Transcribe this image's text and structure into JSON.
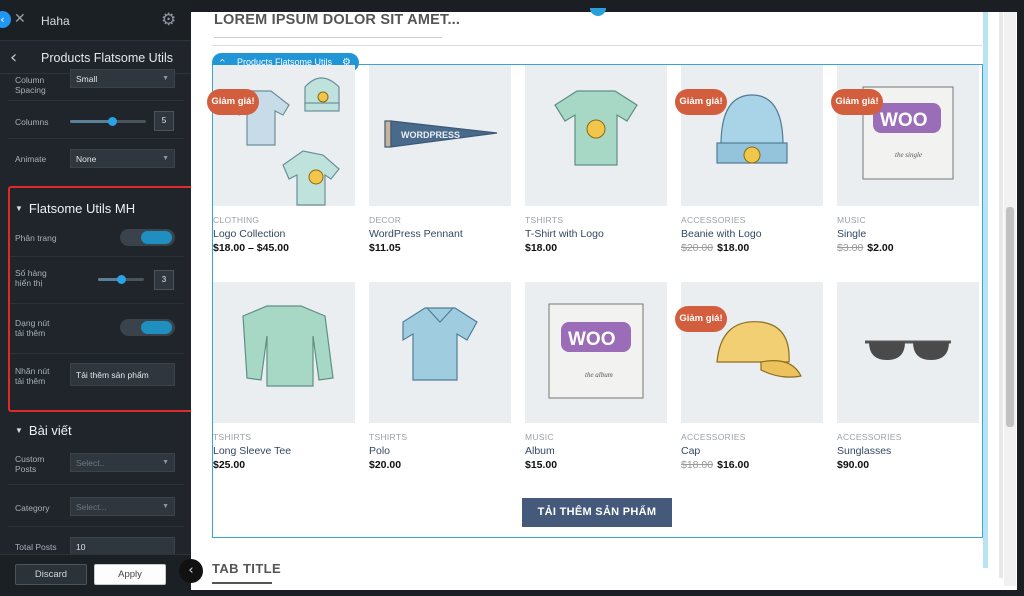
{
  "topbar": {
    "collapse_icon": "‹",
    "close_icon": "✕",
    "title": "Haha",
    "gear_icon": "⚙"
  },
  "subbar": {
    "back_icon": "‹",
    "title": "Products Flatsome Utils"
  },
  "panel": {
    "spacing": {
      "label": "Column\nSpacing",
      "value": "Small"
    },
    "columns": {
      "label": "Columns",
      "value": "5",
      "level": 0.55
    },
    "animate": {
      "label": "Animate",
      "value": "None"
    },
    "mh_section": {
      "title": "Flatsome Utils MH"
    },
    "phan_trang": {
      "label": "Phân trang",
      "on": true
    },
    "so_hang": {
      "label": "Số hàng\nhiển thị",
      "value": "3",
      "level": 0.49
    },
    "dang_nut": {
      "label": "Dạng nút\ntải thêm",
      "on": true
    },
    "nhan_nut": {
      "label": "Nhãn nút\ntải thêm",
      "value": "Tải thêm sản phẩm"
    },
    "bai_viet": {
      "title": "Bài viết"
    },
    "custom_posts": {
      "label": "Custom\nPosts",
      "placeholder": "Select.."
    },
    "category": {
      "label": "Category",
      "placeholder": "Select..."
    },
    "total_posts": {
      "label": "Total Posts",
      "value": "10"
    }
  },
  "footer": {
    "discard": "Discard",
    "apply": "Apply",
    "toggle_icon": "‹"
  },
  "preview": {
    "lorem": "LOREM IPSUM DOLOR SIT AMET...",
    "element_tag": "Products Flatsome Utils",
    "load_more": "TẢI THÊM SẢN PHẨM",
    "tab_title": "TAB TITLE",
    "sale_badge": "Giảm giá!",
    "products": [
      {
        "category": "CLOTHING",
        "name": "Logo Collection",
        "price": "$18.00 – $45.00",
        "old_price": "",
        "sale": true,
        "icon": "clothing-icon"
      },
      {
        "category": "DECOR",
        "name": "WordPress Pennant",
        "price": "$11.05",
        "old_price": "",
        "sale": false,
        "icon": "pennant-icon"
      },
      {
        "category": "TSHIRTS",
        "name": "T-Shirt with Logo",
        "price": "$18.00",
        "old_price": "",
        "sale": false,
        "icon": "tshirt-icon"
      },
      {
        "category": "ACCESSORIES",
        "name": "Beanie with Logo",
        "price": "$18.00",
        "old_price": "$20.00",
        "sale": true,
        "icon": "beanie-icon"
      },
      {
        "category": "MUSIC",
        "name": "Single",
        "price": "$2.00",
        "old_price": "$3.00",
        "sale": true,
        "icon": "woo-single-icon"
      },
      {
        "category": "TSHIRTS",
        "name": "Long Sleeve Tee",
        "price": "$25.00",
        "old_price": "",
        "sale": false,
        "icon": "long-sleeve-icon"
      },
      {
        "category": "TSHIRTS",
        "name": "Polo",
        "price": "$20.00",
        "old_price": "",
        "sale": false,
        "icon": "polo-icon"
      },
      {
        "category": "MUSIC",
        "name": "Album",
        "price": "$15.00",
        "old_price": "",
        "sale": false,
        "icon": "woo-album-icon"
      },
      {
        "category": "ACCESSORIES",
        "name": "Cap",
        "price": "$16.00",
        "old_price": "$18.00",
        "sale": true,
        "icon": "cap-icon"
      },
      {
        "category": "ACCESSORIES",
        "name": "Sunglasses",
        "price": "$90.00",
        "old_price": "",
        "sale": false,
        "icon": "sunglasses-icon"
      }
    ]
  },
  "colors": {
    "accent": "#2196d6",
    "sale": "#d35e3e",
    "button": "#45597a",
    "highlight": "#e02a2a"
  }
}
